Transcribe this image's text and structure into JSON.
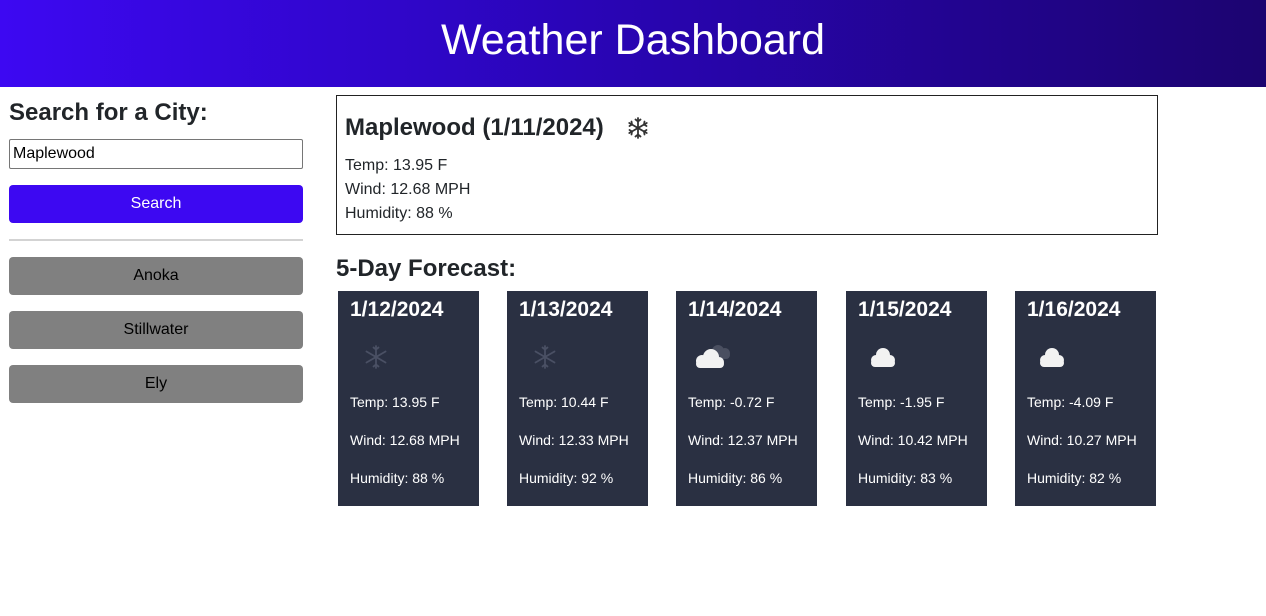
{
  "header": {
    "title": "Weather Dashboard"
  },
  "search": {
    "title": "Search for a City:",
    "input_value": "Maplewood",
    "button_label": "Search"
  },
  "history": [
    "Anoka",
    "Stillwater",
    "Ely"
  ],
  "current": {
    "title": "Maplewood (1/11/2024)",
    "icon": "snow-icon",
    "temp": "Temp: 13.95 F",
    "wind": "Wind: 12.68 MPH",
    "humidity": "Humidity: 88 %"
  },
  "forecast": {
    "title": "5-Day Forecast:",
    "days": [
      {
        "date": "1/12/2024",
        "icon": "snow-icon",
        "temp": "Temp: 13.95 F",
        "wind": "Wind: 12.68 MPH",
        "humidity": "Humidity: 88 %"
      },
      {
        "date": "1/13/2024",
        "icon": "snow-icon",
        "temp": "Temp: 10.44 F",
        "wind": "Wind: 12.33 MPH",
        "humidity": "Humidity: 92 %"
      },
      {
        "date": "1/14/2024",
        "icon": "broken-clouds-icon",
        "temp": "Temp: -0.72 F",
        "wind": "Wind: 12.37 MPH",
        "humidity": "Humidity: 86 %"
      },
      {
        "date": "1/15/2024",
        "icon": "cloud-icon",
        "temp": "Temp: -1.95 F",
        "wind": "Wind: 10.42 MPH",
        "humidity": "Humidity: 83 %"
      },
      {
        "date": "1/16/2024",
        "icon": "cloud-icon",
        "temp": "Temp: -4.09 F",
        "wind": "Wind: 10.27 MPH",
        "humidity": "Humidity: 82 %"
      }
    ]
  },
  "colors": {
    "accent": "#3d08f2",
    "history_button": "#808080",
    "card_bg": "#2a3042"
  }
}
